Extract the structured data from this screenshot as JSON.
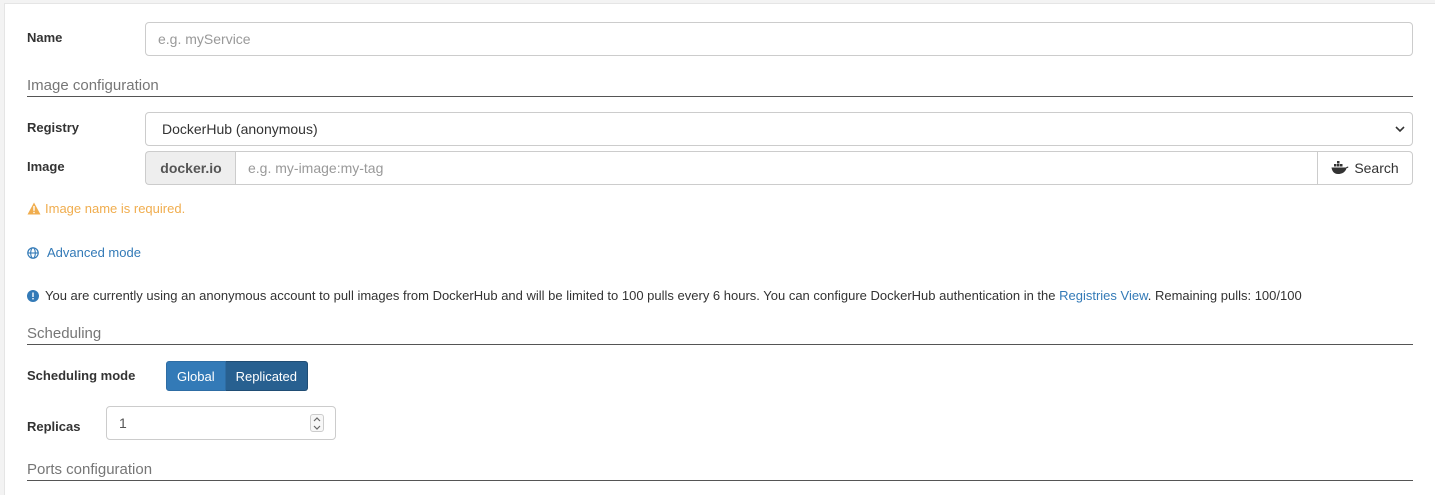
{
  "name": {
    "label": "Name",
    "placeholder": "e.g. myService",
    "value": ""
  },
  "image_config": {
    "title": "Image configuration",
    "registry": {
      "label": "Registry",
      "selected": "DockerHub (anonymous)"
    },
    "image": {
      "label": "Image",
      "prefix": "docker.io",
      "placeholder": "e.g. my-image:my-tag",
      "value": "",
      "search_label": "Search"
    },
    "warning": "Image name is required.",
    "advanced_mode": "Advanced mode",
    "info": {
      "text_before": "You are currently using an anonymous account to pull images from DockerHub and will be limited to 100 pulls every 6 hours. You can configure DockerHub authentication in the ",
      "link": "Registries View",
      "text_after": ". Remaining pulls: 100/100"
    }
  },
  "scheduling": {
    "title": "Scheduling",
    "mode_label": "Scheduling mode",
    "modes": [
      "Global",
      "Replicated"
    ],
    "active_mode": "Replicated",
    "replicas_label": "Replicas",
    "replicas_value": "1"
  },
  "ports": {
    "title": "Ports configuration"
  },
  "colors": {
    "primary": "#337ab7",
    "primary_active": "#286090",
    "warning": "#f0ad4e"
  }
}
